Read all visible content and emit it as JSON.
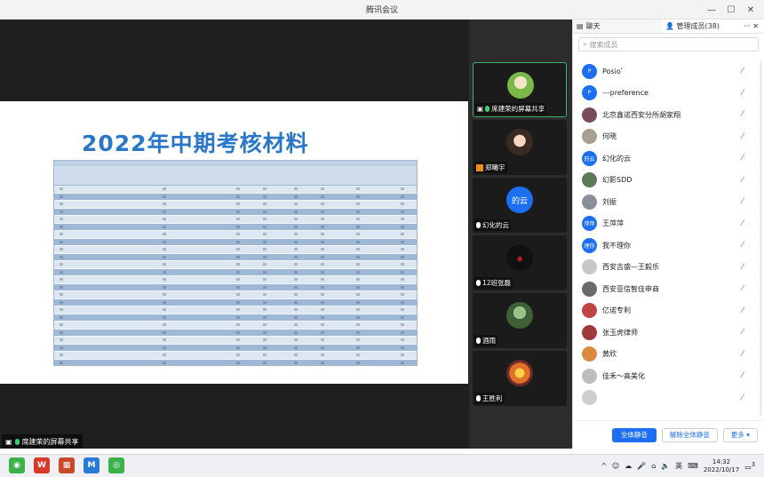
{
  "window": {
    "title": "腾讯会议"
  },
  "stage": {
    "slide_title": "2022年中期考核材料",
    "share_label": "席建荣的屏幕共享"
  },
  "tiles": [
    {
      "label": "席建荣的屏幕共享",
      "mic": "green"
    },
    {
      "label": "郑曦宇",
      "mic": "none"
    },
    {
      "label": "幻化的云",
      "avatar_text": "的云",
      "mic": "white"
    },
    {
      "label": "12班张磊",
      "mic": "white"
    },
    {
      "label": "酒雨",
      "mic": "white"
    },
    {
      "label": "王胜利",
      "mic": "white"
    }
  ],
  "panel": {
    "tab_chat": "聊天",
    "tab_members": "管理成员(38)",
    "search_placeholder": "搜索成员",
    "members": [
      {
        "name": "Posio゛",
        "avatar": "P",
        "color": "#1d6ff2"
      },
      {
        "name": "---preference",
        "avatar": "P",
        "color": "#1d6ff2"
      },
      {
        "name": "北京鑫诺西安分所胡家翔",
        "avatar": "",
        "color": "#7a4b5a"
      },
      {
        "name": "何晓",
        "avatar": "",
        "color": "#a8a090"
      },
      {
        "name": "幻化的云",
        "avatar": "的云",
        "color": "#1d6ff2"
      },
      {
        "name": "幻影SDD",
        "avatar": "",
        "color": "#5a7a5a"
      },
      {
        "name": "刘振",
        "avatar": "",
        "color": "#8a8f99"
      },
      {
        "name": "王萍萍",
        "avatar": "萍萍",
        "color": "#1d6ff2"
      },
      {
        "name": "我不理你",
        "avatar": "理你",
        "color": "#1d6ff2"
      },
      {
        "name": "西安吉盛—王毅乐",
        "avatar": "",
        "color": "#c8c8c8"
      },
      {
        "name": "西安亚信智佳申商",
        "avatar": "",
        "color": "#6a6a6a"
      },
      {
        "name": "亿诺专利",
        "avatar": "",
        "color": "#c04444"
      },
      {
        "name": "张玉虎律师",
        "avatar": "",
        "color": "#a03a3a"
      },
      {
        "name": "黄欣",
        "avatar": "",
        "color": "#d98a3a"
      },
      {
        "name": "佳禾～高美化",
        "avatar": "",
        "color": "#bdbdbd"
      },
      {
        "name": "",
        "avatar": "",
        "color": "#cfcfcf"
      }
    ],
    "btn_mute_all": "全体静音",
    "btn_unmute_all": "解除全体静音",
    "btn_more": "更多 ▾"
  },
  "taskbar": {
    "ime": "英",
    "time": "14:32",
    "date": "2022/10/17",
    "badge": "3"
  }
}
